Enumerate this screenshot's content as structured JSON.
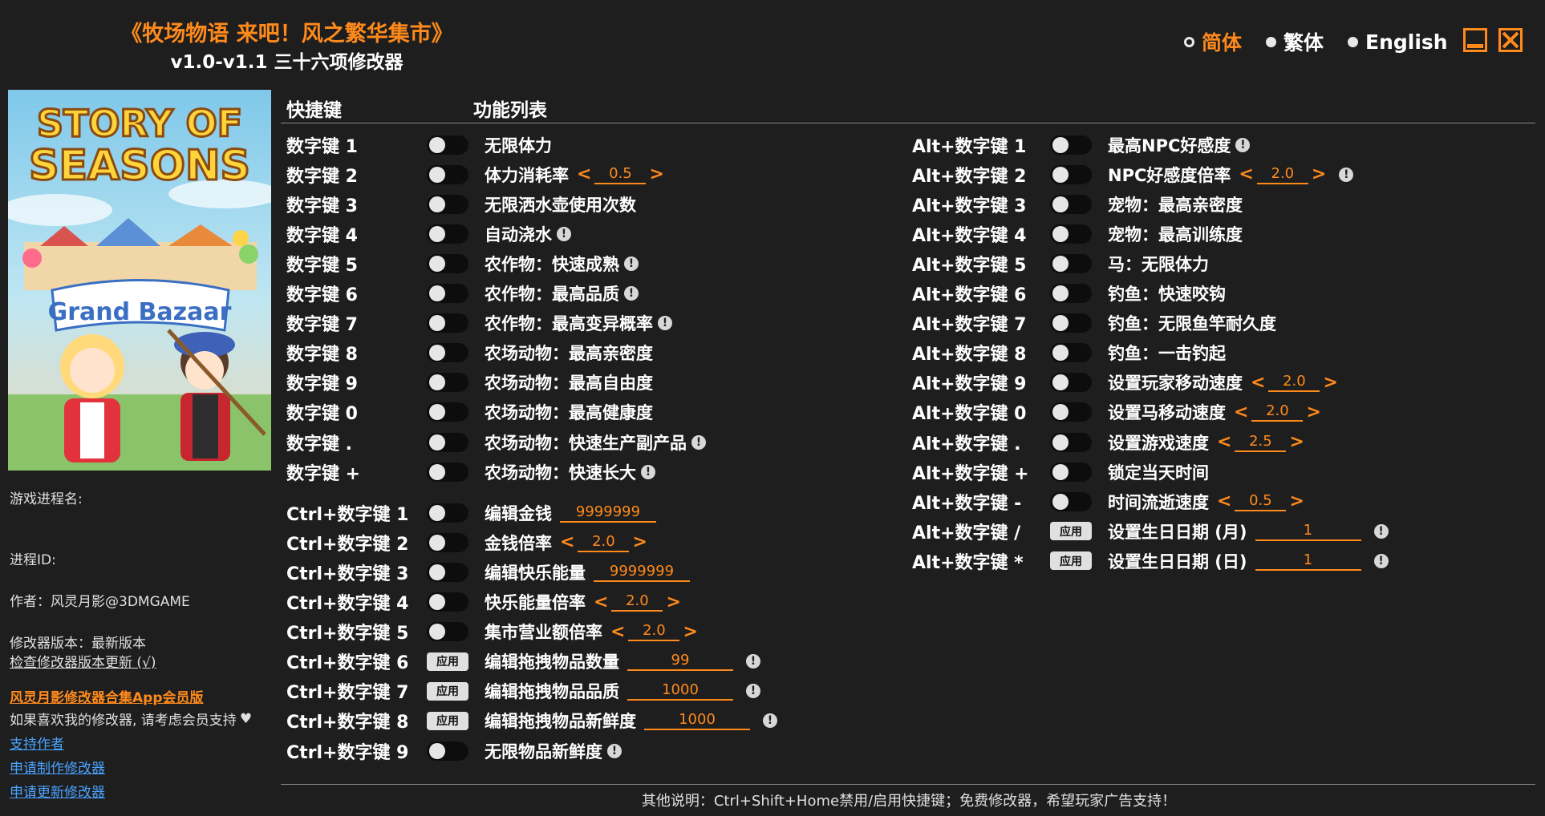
{
  "header": {
    "title": "《牧场物语 来吧！风之繁华集市》",
    "subtitle": "v1.0-v1.1 三十六项修改器",
    "languages": [
      {
        "label": "简体",
        "selected": true
      },
      {
        "label": "繁体",
        "selected": false
      },
      {
        "label": "English",
        "selected": false
      }
    ]
  },
  "cover": {
    "logo_line1": "STORY OF",
    "logo_line2": "SEASONS",
    "logo_line3": "Grand Bazaar"
  },
  "sidebar": {
    "process_name_label": "游戏进程名:",
    "process_id_label": "进程ID:",
    "author": "作者：风灵月影@3DMGAME",
    "version": "修改器版本：最新版本",
    "check_update": "检查修改器版本更新 (√)",
    "app_link": "风灵月影修改器合集App会员版",
    "support_text": "如果喜欢我的修改器, 请考虑会员支持",
    "support_author": "支持作者",
    "request_trainer": "申请制作修改器",
    "request_update": "申请更新修改器"
  },
  "table": {
    "col_hotkey": "快捷键",
    "col_features": "功能列表"
  },
  "left_options": [
    {
      "key": "数字键 1",
      "label": "无限体力"
    },
    {
      "key": "数字键 2",
      "label": "体力消耗率",
      "value": "0.5",
      "stepper": true
    },
    {
      "key": "数字键 3",
      "label": "无限洒水壶使用次数"
    },
    {
      "key": "数字键 4",
      "label": "自动浇水",
      "info": true
    },
    {
      "key": "数字键 5",
      "label": "农作物：快速成熟",
      "info": true
    },
    {
      "key": "数字键 6",
      "label": "农作物：最高品质",
      "info": true
    },
    {
      "key": "数字键 7",
      "label": "农作物：最高变异概率",
      "info": true
    },
    {
      "key": "数字键 8",
      "label": "农场动物：最高亲密度"
    },
    {
      "key": "数字键 9",
      "label": "农场动物：最高自由度"
    },
    {
      "key": "数字键 0",
      "label": "农场动物：最高健康度"
    },
    {
      "key": "数字键 .",
      "label": "农场动物：快速生产副产品",
      "info": true
    },
    {
      "key": "数字键 +",
      "label": "农场动物：快速长大",
      "info": true
    },
    {
      "key": "Ctrl+数字键 1",
      "label": "编辑金钱",
      "value": "9999999"
    },
    {
      "key": "Ctrl+数字键 2",
      "label": "金钱倍率",
      "value": "2.0",
      "stepper": true
    },
    {
      "key": "Ctrl+数字键 3",
      "label": "编辑快乐能量",
      "value": "9999999"
    },
    {
      "key": "Ctrl+数字键 4",
      "label": "快乐能量倍率",
      "value": "2.0",
      "stepper": true
    },
    {
      "key": "Ctrl+数字键 5",
      "label": "集市营业额倍率",
      "value": "2.0",
      "stepper": true
    },
    {
      "key": "Ctrl+数字键 6",
      "label": "编辑拖拽物品数量",
      "value": "99",
      "apply": true,
      "info": true
    },
    {
      "key": "Ctrl+数字键 7",
      "label": "编辑拖拽物品品质",
      "value": "1000",
      "apply": true,
      "info": true
    },
    {
      "key": "Ctrl+数字键 8",
      "label": "编辑拖拽物品新鲜度",
      "value": "1000",
      "apply": true,
      "info": true
    },
    {
      "key": "Ctrl+数字键 9",
      "label": "无限物品新鲜度",
      "info": true
    }
  ],
  "right_options": [
    {
      "key": "Alt+数字键 1",
      "label": "最高NPC好感度",
      "info": true
    },
    {
      "key": "Alt+数字键 2",
      "label": "NPC好感度倍率",
      "value": "2.0",
      "stepper": true,
      "info": true
    },
    {
      "key": "Alt+数字键 3",
      "label": "宠物：最高亲密度"
    },
    {
      "key": "Alt+数字键 4",
      "label": "宠物：最高训练度"
    },
    {
      "key": "Alt+数字键 5",
      "label": "马：无限体力"
    },
    {
      "key": "Alt+数字键 6",
      "label": "钓鱼：快速咬钩"
    },
    {
      "key": "Alt+数字键 7",
      "label": "钓鱼：无限鱼竿耐久度"
    },
    {
      "key": "Alt+数字键 8",
      "label": "钓鱼：一击钓起"
    },
    {
      "key": "Alt+数字键 9",
      "label": "设置玩家移动速度",
      "value": "2.0",
      "stepper": true
    },
    {
      "key": "Alt+数字键 0",
      "label": "设置马移动速度",
      "value": "2.0",
      "stepper": true
    },
    {
      "key": "Alt+数字键 .",
      "label": "设置游戏速度",
      "value": "2.5",
      "stepper": true
    },
    {
      "key": "Alt+数字键 +",
      "label": "锁定当天时间"
    },
    {
      "key": "Alt+数字键 -",
      "label": "时间流逝速度",
      "value": "0.5",
      "stepper": true
    },
    {
      "key": "Alt+数字键 /",
      "label": "设置生日日期 (月)",
      "value": "1",
      "apply": true,
      "info": true
    },
    {
      "key": "Alt+数字键 *",
      "label": "设置生日日期 (日)",
      "value": "1",
      "apply": true,
      "info": true
    }
  ],
  "apply_label": "应用",
  "footer": "其他说明：Ctrl+Shift+Home禁用/启用快捷键；免费修改器，希望玩家广告支持！",
  "colors": {
    "accent": "#ff8a1c",
    "background": "#1e1e1e",
    "link": "#4aa3ff"
  }
}
